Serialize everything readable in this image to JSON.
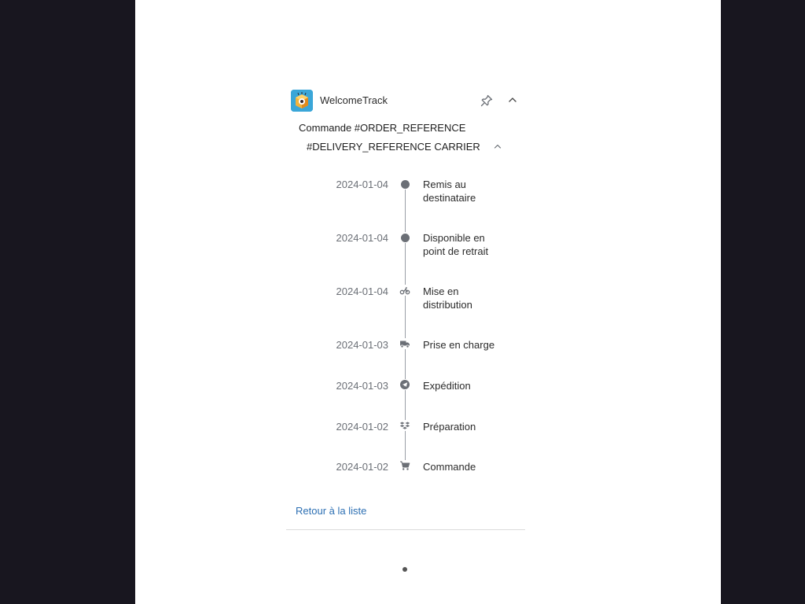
{
  "app": {
    "name": "WelcomeTrack",
    "icon": "box-eye-logo-icon",
    "accent": "#3aa6d8"
  },
  "header": {
    "pin_icon": "pin-icon",
    "collapse_icon": "chevron-up-icon"
  },
  "order": {
    "title": "Commande #ORDER_REFERENCE"
  },
  "delivery": {
    "title": "#DELIVERY_REFERENCE CARRIER",
    "collapse_icon": "chevron-up-icon"
  },
  "timeline": {
    "events": [
      {
        "date": "2024-01-04",
        "label": "Remis au destinataire",
        "icon": "dot-icon"
      },
      {
        "date": "2024-01-04",
        "label": "Disponible en point de retrait",
        "icon": "dot-icon"
      },
      {
        "date": "2024-01-04",
        "label": "Mise en distribution",
        "icon": "scooter-icon"
      },
      {
        "date": "2024-01-03",
        "label": "Prise en charge",
        "icon": "truck-icon"
      },
      {
        "date": "2024-01-03",
        "label": "Expédition",
        "icon": "send-icon"
      },
      {
        "date": "2024-01-02",
        "label": "Préparation",
        "icon": "boxes-icon"
      },
      {
        "date": "2024-01-02",
        "label": "Commande",
        "icon": "cart-icon"
      }
    ]
  },
  "footer": {
    "back_link": "Retour à la liste"
  },
  "colors": {
    "link": "#2c6fb3",
    "marker": "#6b6f76",
    "background_outer": "#18161f"
  }
}
